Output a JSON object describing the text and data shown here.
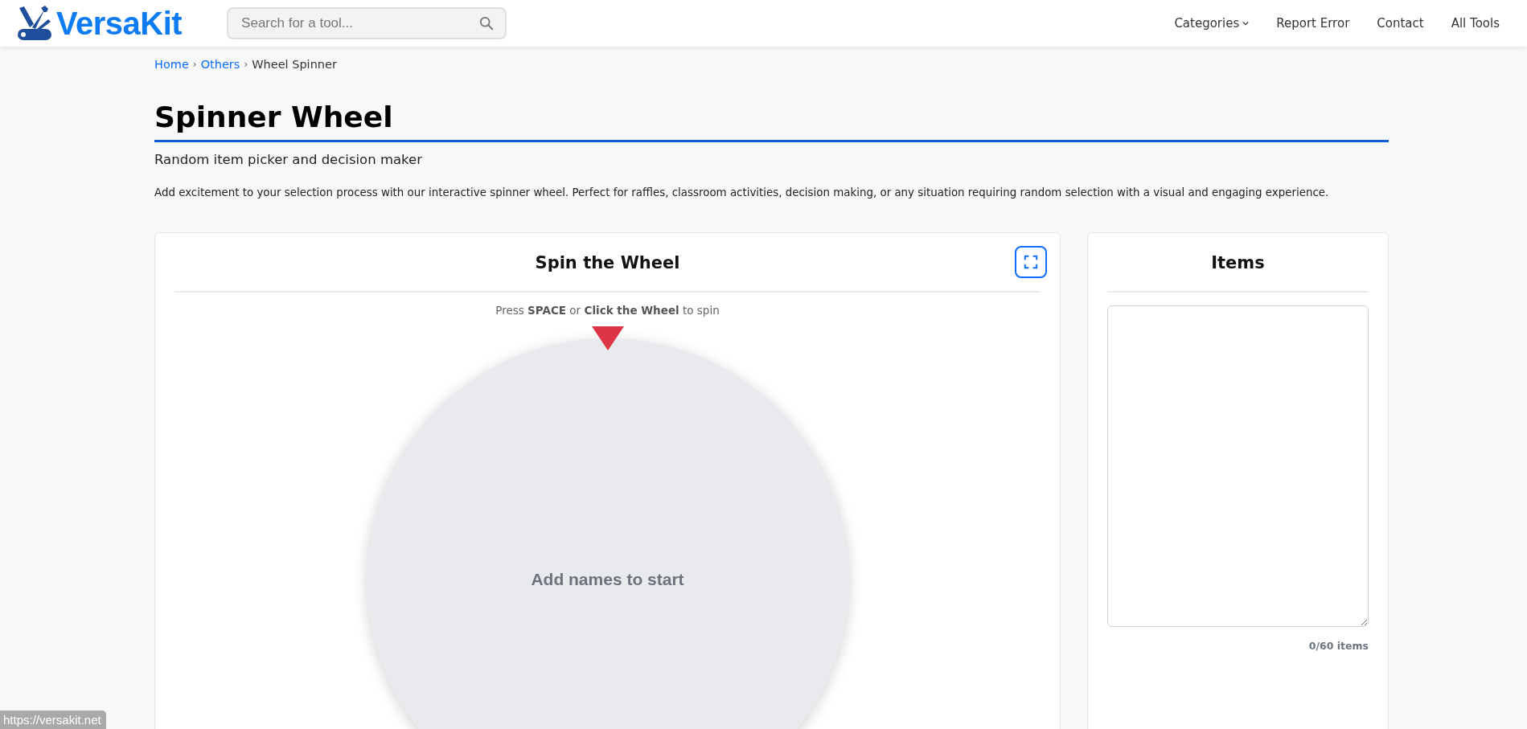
{
  "header": {
    "logo": "VersaKit",
    "search": {
      "placeholder": "Search for a tool..."
    },
    "nav": [
      {
        "label": "Categories",
        "kind": "dropdown"
      },
      {
        "label": "Report Error",
        "kind": "link"
      },
      {
        "label": "Contact",
        "kind": "link"
      },
      {
        "label": "All Tools",
        "kind": "link"
      }
    ]
  },
  "breadcrumb": {
    "separator": "›",
    "items": [
      {
        "label": "Home",
        "kind": "link"
      },
      {
        "label": "Others",
        "kind": "link"
      },
      {
        "label": "Wheel Spinner",
        "kind": "current"
      }
    ]
  },
  "page": {
    "title": "Spinner Wheel",
    "subtitle": "Random item picker and decision maker",
    "description": "Add excitement to your selection process with our interactive spinner wheel. Perfect for raffles, classroom activities, decision making, or any situation requiring random selection with a visual and engaging experience."
  },
  "wheel_panel": {
    "title": "Spin the Wheel",
    "hint": "Press **SPACE** or **Click the Wheel** to spin",
    "empty_message": "Add names to start"
  },
  "items_panel": {
    "title": "Items",
    "count": "0/60 items"
  },
  "status_link": "https://versakit.net"
}
